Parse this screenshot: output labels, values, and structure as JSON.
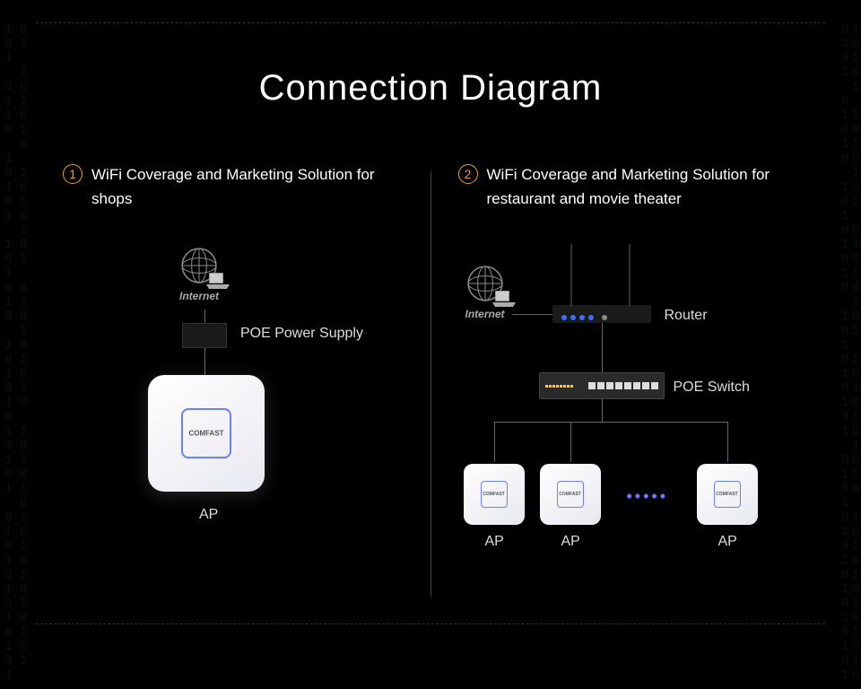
{
  "title": "Connection Diagram",
  "brand": "COMFAST",
  "internet_label": "Internet",
  "sections": {
    "left": {
      "num": "1",
      "title": "WiFi Coverage and Marketing Solution for shops",
      "labels": {
        "poe_supply": "POE Power Supply",
        "ap": "AP"
      }
    },
    "right": {
      "num": "2",
      "title": "WiFi Coverage and Marketing Solution for restaurant and movie theater",
      "labels": {
        "router": "Router",
        "poe_switch": "POE Switch",
        "ap1": "AP",
        "ap2": "AP",
        "ap3": "AP"
      }
    }
  }
}
